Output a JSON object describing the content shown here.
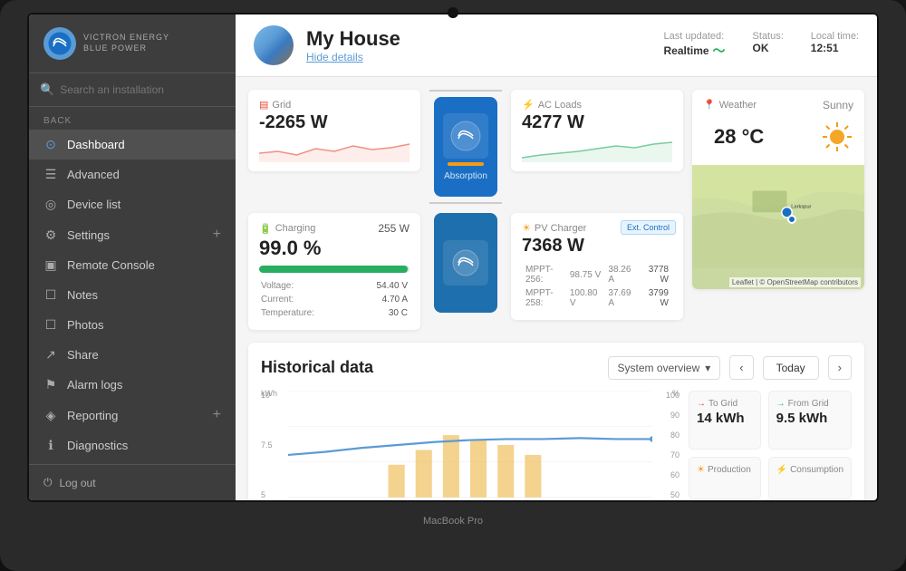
{
  "laptop": {
    "model": "MacBook Pro"
  },
  "sidebar": {
    "logo_text": "victron energy",
    "logo_subtext": "BLUE POWER",
    "search_placeholder": "Search an installation",
    "back_label": "BACK",
    "items": [
      {
        "id": "dashboard",
        "label": "Dashboard",
        "icon": "⊙",
        "active": true
      },
      {
        "id": "advanced",
        "label": "Advanced",
        "icon": "☰",
        "active": false
      },
      {
        "id": "device-list",
        "label": "Device list",
        "icon": "◎",
        "active": false
      },
      {
        "id": "settings",
        "label": "Settings",
        "icon": "⚙",
        "active": false,
        "has_add": true
      },
      {
        "id": "remote-console",
        "label": "Remote Console",
        "icon": "▣",
        "active": false
      },
      {
        "id": "notes",
        "label": "Notes",
        "icon": "☐",
        "active": false
      },
      {
        "id": "photos",
        "label": "Photos",
        "icon": "☐",
        "active": false
      },
      {
        "id": "share",
        "label": "Share",
        "icon": "↗",
        "active": false
      },
      {
        "id": "alarm-logs",
        "label": "Alarm logs",
        "icon": "⚑",
        "active": false
      },
      {
        "id": "reporting",
        "label": "Reporting",
        "icon": "◈",
        "active": false,
        "has_add": true
      },
      {
        "id": "diagnostics",
        "label": "Diagnostics",
        "icon": "ℹ",
        "active": false
      }
    ],
    "logout_label": "Log out"
  },
  "header": {
    "house_name": "My House",
    "hide_details": "Hide details",
    "last_updated_label": "Last updated:",
    "last_updated_value": "Realtime",
    "status_label": "Status:",
    "status_value": "OK",
    "local_time_label": "Local time:",
    "local_time_value": "12:51"
  },
  "cards": {
    "grid": {
      "title": "Grid",
      "value": "-2265 W",
      "icon_color": "#e74c3c"
    },
    "inverter": {
      "label": "Absorption"
    },
    "ac_loads": {
      "title": "AC Loads",
      "value": "4277 W"
    },
    "charging": {
      "title": "Charging",
      "watts": "255 W",
      "percentage": "99.0 %",
      "voltage_label": "Voltage:",
      "voltage_value": "54.40 V",
      "current_label": "Current:",
      "current_value": "4.70 A",
      "temperature_label": "Temperature:",
      "temperature_value": "30 C"
    },
    "pv_charger": {
      "title": "PV Charger",
      "value": "7368 W",
      "ext_control": "Ext. Control",
      "mppt256_label": "MPPT-256:",
      "mppt256_v": "98.75 V",
      "mppt256_a": "38.26 A",
      "mppt256_w": "3778 W",
      "mppt258_label": "MPPT-258:",
      "mppt258_v": "100.80 V",
      "mppt258_a": "37.69 A",
      "mppt258_w": "3799 W"
    },
    "weather": {
      "title": "Weather",
      "status": "Sunny",
      "temperature": "28 °C",
      "map_credit": "Leaflet | © OpenStreetMap contributors"
    }
  },
  "historical": {
    "title": "Historical data",
    "dropdown_label": "System overview",
    "nav_prev": "‹",
    "nav_next": "›",
    "today_label": "Today",
    "kwh_label": "kWh",
    "pct_label": "%",
    "y_axis": [
      "10",
      "7.5",
      "5"
    ],
    "y_axis_right": [
      "100",
      "90",
      "80",
      "70",
      "60",
      "50"
    ],
    "stats": {
      "to_grid_label": "To Grid",
      "to_grid_value": "14 kWh",
      "from_grid_label": "From Grid",
      "from_grid_value": "9.5 kWh",
      "production_label": "Production",
      "consumption_label": "Consumption"
    }
  }
}
